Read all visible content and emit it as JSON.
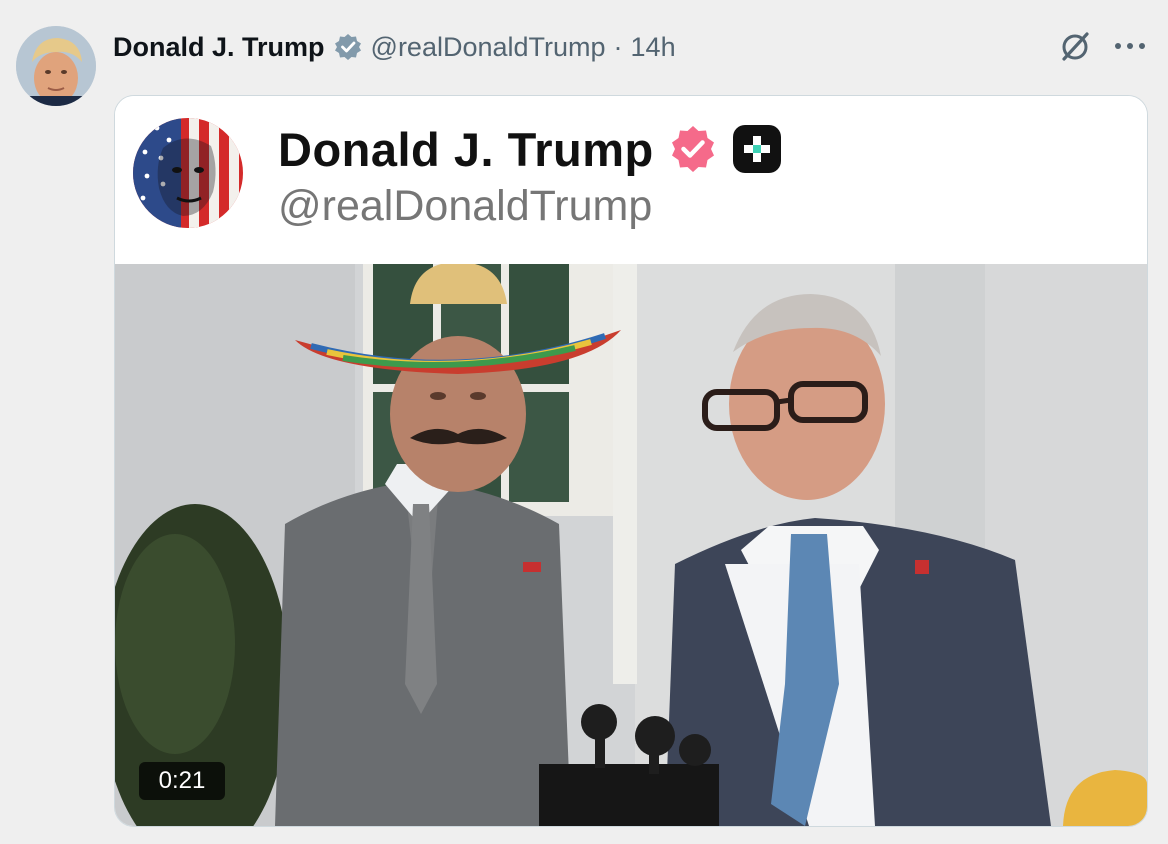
{
  "post": {
    "author_name": "Donald J. Trump",
    "author_handle": "@realDonaldTrump",
    "separator": "·",
    "timestamp": "14h",
    "icons": [
      "verified-badge-icon",
      "grok-icon",
      "more-options-icon"
    ]
  },
  "embedded_card": {
    "author_name": "Donald J. Trump",
    "author_handle": "@realDonaldTrump",
    "icons": [
      "pink-verified-badge-icon",
      "plus-app-icon"
    ]
  },
  "video": {
    "duration": "0:21"
  },
  "colors": {
    "verified_blue_gray": "#829aab",
    "pink_badge": "#f56a8a",
    "handle_gray": "#536471"
  }
}
